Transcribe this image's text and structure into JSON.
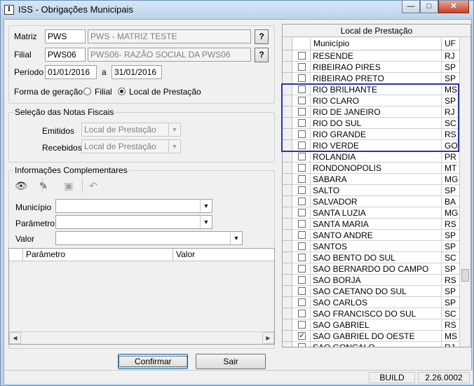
{
  "window": {
    "title": "ISS - Obrigações Municipais",
    "app_icon_text": "I",
    "minimize_glyph": "—",
    "maximize_glyph": "□",
    "close_glyph": "✕"
  },
  "header": {
    "matriz_label": "Matriz",
    "matriz_code": "PWS",
    "matriz_name": "PWS - MATRIZ TESTE",
    "filial_label": "Filial",
    "filial_code": "PWS06",
    "filial_name": "PWS06- RAZÃO SOCIAL DA PWS06",
    "lookup_label": "?",
    "periodo_label": "Período",
    "periodo_start": "01/01/2016",
    "periodo_sep": "a",
    "periodo_end": "31/01/2016",
    "forma_label": "Forma de geração",
    "forma_option_filial": "Filial",
    "forma_option_local": "Local de Prestação",
    "forma_selected": "Local de Prestação"
  },
  "selecao": {
    "title": "Seleção das Notas Fiscais",
    "emitidos_label": "Emitidos",
    "emitidos_value": "Local de Prestação",
    "recebidos_label": "Recebidos",
    "recebidos_value": "Local de Prestação"
  },
  "info": {
    "title": "Informações Complementares",
    "toolbar": [
      {
        "name": "binoculars-icon",
        "glyph": "👁",
        "enabled": true
      },
      {
        "name": "edit-icon",
        "glyph": "✎",
        "enabled": true
      },
      {
        "name": "save-icon",
        "glyph": "▣",
        "enabled": false
      },
      {
        "name": "undo-icon",
        "glyph": "↶",
        "enabled": false
      }
    ],
    "municipio_label": "Município",
    "parametro_label": "Parâmetro",
    "valor_label": "Valor",
    "grid_col_parametro": "Parâmetro",
    "grid_col_valor": "Valor"
  },
  "local": {
    "title": "Local de Prestação",
    "col_municipio": "Município",
    "col_uf": "UF",
    "rows": [
      {
        "city": "RESENDE",
        "uf": "RJ",
        "checked": false
      },
      {
        "city": "RIBEIRAO PIRES",
        "uf": "SP",
        "checked": false
      },
      {
        "city": "RIBEIRAO PRETO",
        "uf": "SP",
        "checked": false
      },
      {
        "city": "RIO BRILHANTE",
        "uf": "MS",
        "checked": false
      },
      {
        "city": "RIO CLARO",
        "uf": "SP",
        "checked": false
      },
      {
        "city": "RIO DE JANEIRO",
        "uf": "RJ",
        "checked": false
      },
      {
        "city": "RIO DO SUL",
        "uf": "SC",
        "checked": false
      },
      {
        "city": "RIO GRANDE",
        "uf": "RS",
        "checked": false
      },
      {
        "city": "RIO VERDE",
        "uf": "GO",
        "checked": false
      },
      {
        "city": "ROLANDIA",
        "uf": "PR",
        "checked": false
      },
      {
        "city": "RONDONOPOLIS",
        "uf": "MT",
        "checked": false
      },
      {
        "city": "SABARA",
        "uf": "MG",
        "checked": false
      },
      {
        "city": "SALTO",
        "uf": "SP",
        "checked": false
      },
      {
        "city": "SALVADOR",
        "uf": "BA",
        "checked": false
      },
      {
        "city": "SANTA LUZIA",
        "uf": "MG",
        "checked": false
      },
      {
        "city": "SANTA MARIA",
        "uf": "RS",
        "checked": false
      },
      {
        "city": "SANTO ANDRE",
        "uf": "SP",
        "checked": false
      },
      {
        "city": "SANTOS",
        "uf": "SP",
        "checked": false
      },
      {
        "city": "SAO BENTO DO SUL",
        "uf": "SC",
        "checked": false
      },
      {
        "city": "SAO BERNARDO DO CAMPO",
        "uf": "SP",
        "checked": false
      },
      {
        "city": "SAO BORJA",
        "uf": "RS",
        "checked": false
      },
      {
        "city": "SAO CAETANO DO SUL",
        "uf": "SP",
        "checked": false
      },
      {
        "city": "SAO CARLOS",
        "uf": "SP",
        "checked": false
      },
      {
        "city": "SAO FRANCISCO DO SUL",
        "uf": "SC",
        "checked": false
      },
      {
        "city": "SAO GABRIEL",
        "uf": "RS",
        "checked": false
      },
      {
        "city": "SAO GABRIEL DO OESTE",
        "uf": "MS",
        "checked": true
      },
      {
        "city": "SAO GONCALO",
        "uf": "RJ",
        "checked": false
      }
    ],
    "highlight_color": "#2b35a8"
  },
  "buttons": {
    "confirmar": "Confirmar",
    "sair": "Sair"
  },
  "status": {
    "build_label": "BUILD",
    "version": "2.26.0002"
  }
}
